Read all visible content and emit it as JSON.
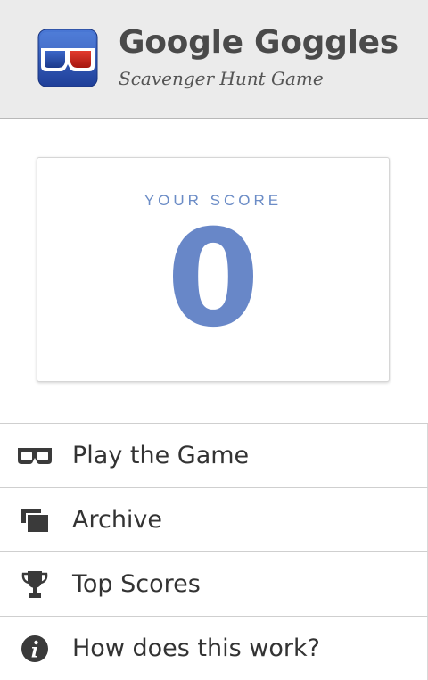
{
  "header": {
    "app_name": "Google Goggles",
    "subtitle": "Scavenger Hunt Game",
    "icon": "goggles-logo-icon"
  },
  "score": {
    "label": "YOUR SCORE",
    "value": "0"
  },
  "menu": {
    "items": [
      {
        "label": "Play the Game",
        "icon": "goggles-icon"
      },
      {
        "label": "Archive",
        "icon": "archive-stack-icon"
      },
      {
        "label": "Top Scores",
        "icon": "trophy-icon"
      },
      {
        "label": "How does this work?",
        "icon": "info-icon"
      }
    ]
  },
  "colors": {
    "header_bg": "#ebebeb",
    "score_accent": "#6887c8",
    "text": "#333333",
    "logo_blue": "#2f55b0",
    "logo_red": "#c8231c"
  }
}
